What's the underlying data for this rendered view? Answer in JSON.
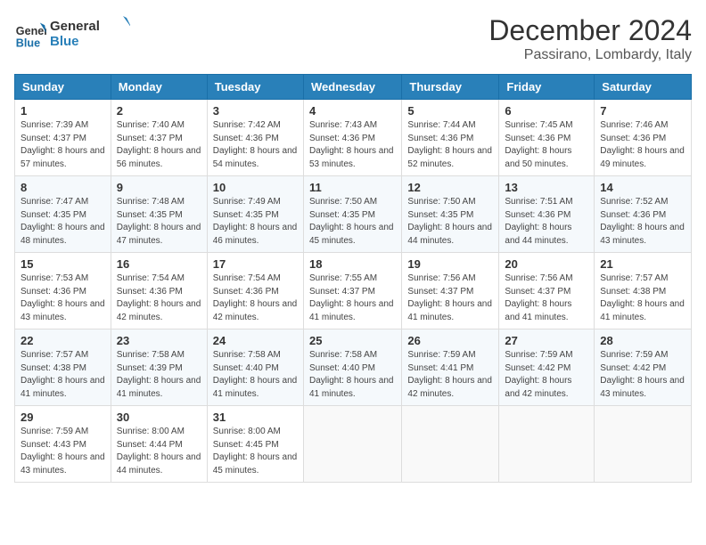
{
  "header": {
    "logo_line1": "General",
    "logo_line2": "Blue",
    "month": "December 2024",
    "location": "Passirano, Lombardy, Italy"
  },
  "weekdays": [
    "Sunday",
    "Monday",
    "Tuesday",
    "Wednesday",
    "Thursday",
    "Friday",
    "Saturday"
  ],
  "weeks": [
    [
      {
        "day": "1",
        "sunrise": "Sunrise: 7:39 AM",
        "sunset": "Sunset: 4:37 PM",
        "daylight": "Daylight: 8 hours and 57 minutes."
      },
      {
        "day": "2",
        "sunrise": "Sunrise: 7:40 AM",
        "sunset": "Sunset: 4:37 PM",
        "daylight": "Daylight: 8 hours and 56 minutes."
      },
      {
        "day": "3",
        "sunrise": "Sunrise: 7:42 AM",
        "sunset": "Sunset: 4:36 PM",
        "daylight": "Daylight: 8 hours and 54 minutes."
      },
      {
        "day": "4",
        "sunrise": "Sunrise: 7:43 AM",
        "sunset": "Sunset: 4:36 PM",
        "daylight": "Daylight: 8 hours and 53 minutes."
      },
      {
        "day": "5",
        "sunrise": "Sunrise: 7:44 AM",
        "sunset": "Sunset: 4:36 PM",
        "daylight": "Daylight: 8 hours and 52 minutes."
      },
      {
        "day": "6",
        "sunrise": "Sunrise: 7:45 AM",
        "sunset": "Sunset: 4:36 PM",
        "daylight": "Daylight: 8 hours and 50 minutes."
      },
      {
        "day": "7",
        "sunrise": "Sunrise: 7:46 AM",
        "sunset": "Sunset: 4:36 PM",
        "daylight": "Daylight: 8 hours and 49 minutes."
      }
    ],
    [
      {
        "day": "8",
        "sunrise": "Sunrise: 7:47 AM",
        "sunset": "Sunset: 4:35 PM",
        "daylight": "Daylight: 8 hours and 48 minutes."
      },
      {
        "day": "9",
        "sunrise": "Sunrise: 7:48 AM",
        "sunset": "Sunset: 4:35 PM",
        "daylight": "Daylight: 8 hours and 47 minutes."
      },
      {
        "day": "10",
        "sunrise": "Sunrise: 7:49 AM",
        "sunset": "Sunset: 4:35 PM",
        "daylight": "Daylight: 8 hours and 46 minutes."
      },
      {
        "day": "11",
        "sunrise": "Sunrise: 7:50 AM",
        "sunset": "Sunset: 4:35 PM",
        "daylight": "Daylight: 8 hours and 45 minutes."
      },
      {
        "day": "12",
        "sunrise": "Sunrise: 7:50 AM",
        "sunset": "Sunset: 4:35 PM",
        "daylight": "Daylight: 8 hours and 44 minutes."
      },
      {
        "day": "13",
        "sunrise": "Sunrise: 7:51 AM",
        "sunset": "Sunset: 4:36 PM",
        "daylight": "Daylight: 8 hours and 44 minutes."
      },
      {
        "day": "14",
        "sunrise": "Sunrise: 7:52 AM",
        "sunset": "Sunset: 4:36 PM",
        "daylight": "Daylight: 8 hours and 43 minutes."
      }
    ],
    [
      {
        "day": "15",
        "sunrise": "Sunrise: 7:53 AM",
        "sunset": "Sunset: 4:36 PM",
        "daylight": "Daylight: 8 hours and 43 minutes."
      },
      {
        "day": "16",
        "sunrise": "Sunrise: 7:54 AM",
        "sunset": "Sunset: 4:36 PM",
        "daylight": "Daylight: 8 hours and 42 minutes."
      },
      {
        "day": "17",
        "sunrise": "Sunrise: 7:54 AM",
        "sunset": "Sunset: 4:36 PM",
        "daylight": "Daylight: 8 hours and 42 minutes."
      },
      {
        "day": "18",
        "sunrise": "Sunrise: 7:55 AM",
        "sunset": "Sunset: 4:37 PM",
        "daylight": "Daylight: 8 hours and 41 minutes."
      },
      {
        "day": "19",
        "sunrise": "Sunrise: 7:56 AM",
        "sunset": "Sunset: 4:37 PM",
        "daylight": "Daylight: 8 hours and 41 minutes."
      },
      {
        "day": "20",
        "sunrise": "Sunrise: 7:56 AM",
        "sunset": "Sunset: 4:37 PM",
        "daylight": "Daylight: 8 hours and 41 minutes."
      },
      {
        "day": "21",
        "sunrise": "Sunrise: 7:57 AM",
        "sunset": "Sunset: 4:38 PM",
        "daylight": "Daylight: 8 hours and 41 minutes."
      }
    ],
    [
      {
        "day": "22",
        "sunrise": "Sunrise: 7:57 AM",
        "sunset": "Sunset: 4:38 PM",
        "daylight": "Daylight: 8 hours and 41 minutes."
      },
      {
        "day": "23",
        "sunrise": "Sunrise: 7:58 AM",
        "sunset": "Sunset: 4:39 PM",
        "daylight": "Daylight: 8 hours and 41 minutes."
      },
      {
        "day": "24",
        "sunrise": "Sunrise: 7:58 AM",
        "sunset": "Sunset: 4:40 PM",
        "daylight": "Daylight: 8 hours and 41 minutes."
      },
      {
        "day": "25",
        "sunrise": "Sunrise: 7:58 AM",
        "sunset": "Sunset: 4:40 PM",
        "daylight": "Daylight: 8 hours and 41 minutes."
      },
      {
        "day": "26",
        "sunrise": "Sunrise: 7:59 AM",
        "sunset": "Sunset: 4:41 PM",
        "daylight": "Daylight: 8 hours and 42 minutes."
      },
      {
        "day": "27",
        "sunrise": "Sunrise: 7:59 AM",
        "sunset": "Sunset: 4:42 PM",
        "daylight": "Daylight: 8 hours and 42 minutes."
      },
      {
        "day": "28",
        "sunrise": "Sunrise: 7:59 AM",
        "sunset": "Sunset: 4:42 PM",
        "daylight": "Daylight: 8 hours and 43 minutes."
      }
    ],
    [
      {
        "day": "29",
        "sunrise": "Sunrise: 7:59 AM",
        "sunset": "Sunset: 4:43 PM",
        "daylight": "Daylight: 8 hours and 43 minutes."
      },
      {
        "day": "30",
        "sunrise": "Sunrise: 8:00 AM",
        "sunset": "Sunset: 4:44 PM",
        "daylight": "Daylight: 8 hours and 44 minutes."
      },
      {
        "day": "31",
        "sunrise": "Sunrise: 8:00 AM",
        "sunset": "Sunset: 4:45 PM",
        "daylight": "Daylight: 8 hours and 45 minutes."
      },
      null,
      null,
      null,
      null
    ]
  ]
}
